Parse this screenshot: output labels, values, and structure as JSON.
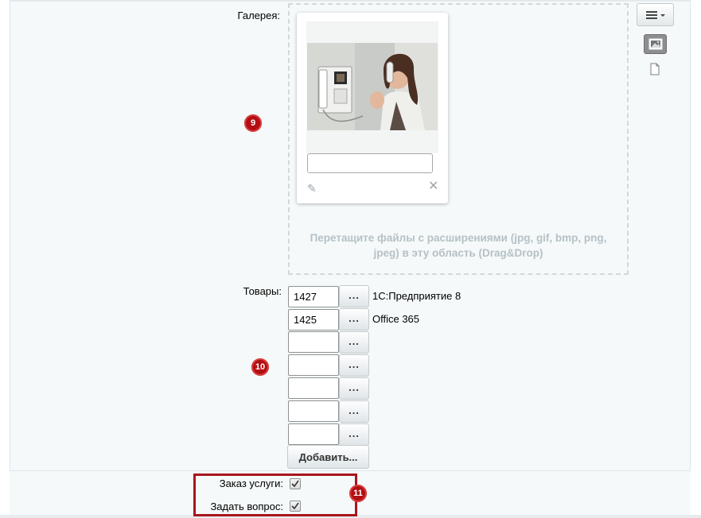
{
  "badges": {
    "gallery": "9",
    "products": "10",
    "checks": "11"
  },
  "gallery": {
    "label": "Галерея:",
    "caption_value": "",
    "dropzone_text": "Перетащите файлы с расширениями (jpg, gif, bmp, png, jpeg) в эту область (Drag&Drop)"
  },
  "toolbar": {
    "menu_icon": "hamburger-dropdown-icon",
    "image_view_icon": "image-icon",
    "file_view_icon": "file-icon"
  },
  "products": {
    "label": "Товары:",
    "rows": [
      {
        "id": "1427",
        "name": "1С:Предприятие 8"
      },
      {
        "id": "1425",
        "name": "Office 365"
      },
      {
        "id": "",
        "name": ""
      },
      {
        "id": "",
        "name": ""
      },
      {
        "id": "",
        "name": ""
      },
      {
        "id": "",
        "name": ""
      },
      {
        "id": "",
        "name": ""
      }
    ],
    "browse_label": "...",
    "add_label": "Добавить..."
  },
  "options": {
    "order_label": "Заказ услуги:",
    "order_checked": true,
    "question_label": "Задать вопрос:",
    "question_checked": true
  },
  "colors": {
    "badge": "#b30f13",
    "highlight": "#a8161c",
    "panel_bg": "#f5f9f9",
    "dropzone_text": "#b6c1c6"
  }
}
